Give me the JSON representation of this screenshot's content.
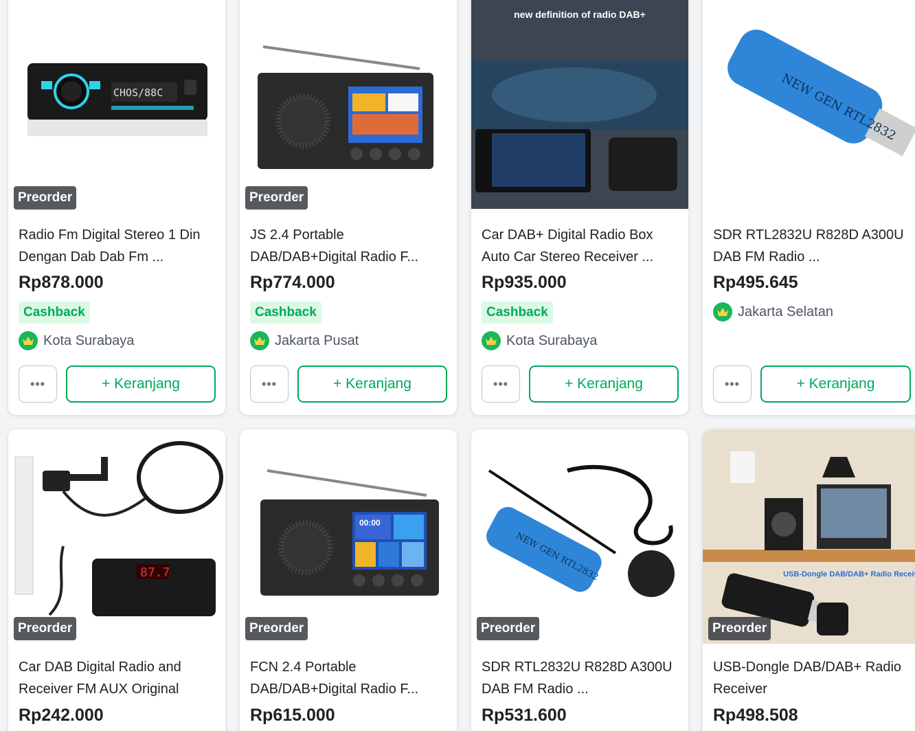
{
  "labels": {
    "preorder": "Preorder",
    "cashback": "Cashback",
    "cart_button": "+ Keranjang",
    "more_button": "•••"
  },
  "colors": {
    "accent_green": "#00aa5b",
    "cashback_bg": "#dbf9e4",
    "badge_bg": "#31353b"
  },
  "products": [
    {
      "title": "Radio Fm Digital Stereo 1 Din Dengan Dab Dab Fm ...",
      "price": "Rp878.000",
      "cashback": true,
      "location": "Kota Surabaya",
      "image_icon": "car-stereo-image",
      "image_text": "CHOS/88C"
    },
    {
      "title": "JS 2.4 Portable DAB/DAB+Digital Radio F...",
      "price": "Rp774.000",
      "cashback": true,
      "location": "Jakarta Pusat",
      "image_icon": "portable-radio-image"
    },
    {
      "title": "Car DAB+ Digital Radio Box Auto Car Stereo Receiver ...",
      "price": "Rp935.000",
      "cashback": true,
      "location": "Kota Surabaya",
      "image_icon": "dab-box-image",
      "image_text": "new definition of radio DAB+"
    },
    {
      "title": "SDR RTL2832U R828D A300U DAB FM Radio ...",
      "price": "Rp495.645",
      "cashback": false,
      "location": "Jakarta Selatan",
      "image_icon": "usb-dongle-image",
      "image_text": "NEW GEN RTL2832"
    },
    {
      "title": "Car DAB Digital Radio and Receiver FM AUX Original",
      "price": "Rp242.000",
      "image_icon": "car-dab-receiver-image",
      "image_text": "87.7"
    },
    {
      "title": "FCN 2.4 Portable DAB/DAB+Digital Radio F...",
      "price": "Rp615.000",
      "image_icon": "portable-radio-image",
      "image_text": "00:00"
    },
    {
      "title": "SDR RTL2832U R828D A300U DAB FM Radio ...",
      "price": "Rp531.600",
      "image_icon": "usb-dongle-antenna-image",
      "image_text": "NEW GEN RTL2832"
    },
    {
      "title": "USB-Dongle DAB/DAB+ Radio Receiver",
      "price": "Rp498.508",
      "image_icon": "room-dongle-image",
      "image_text": "USB-Dongle DAB/DAB+ Radio Receiver"
    }
  ]
}
